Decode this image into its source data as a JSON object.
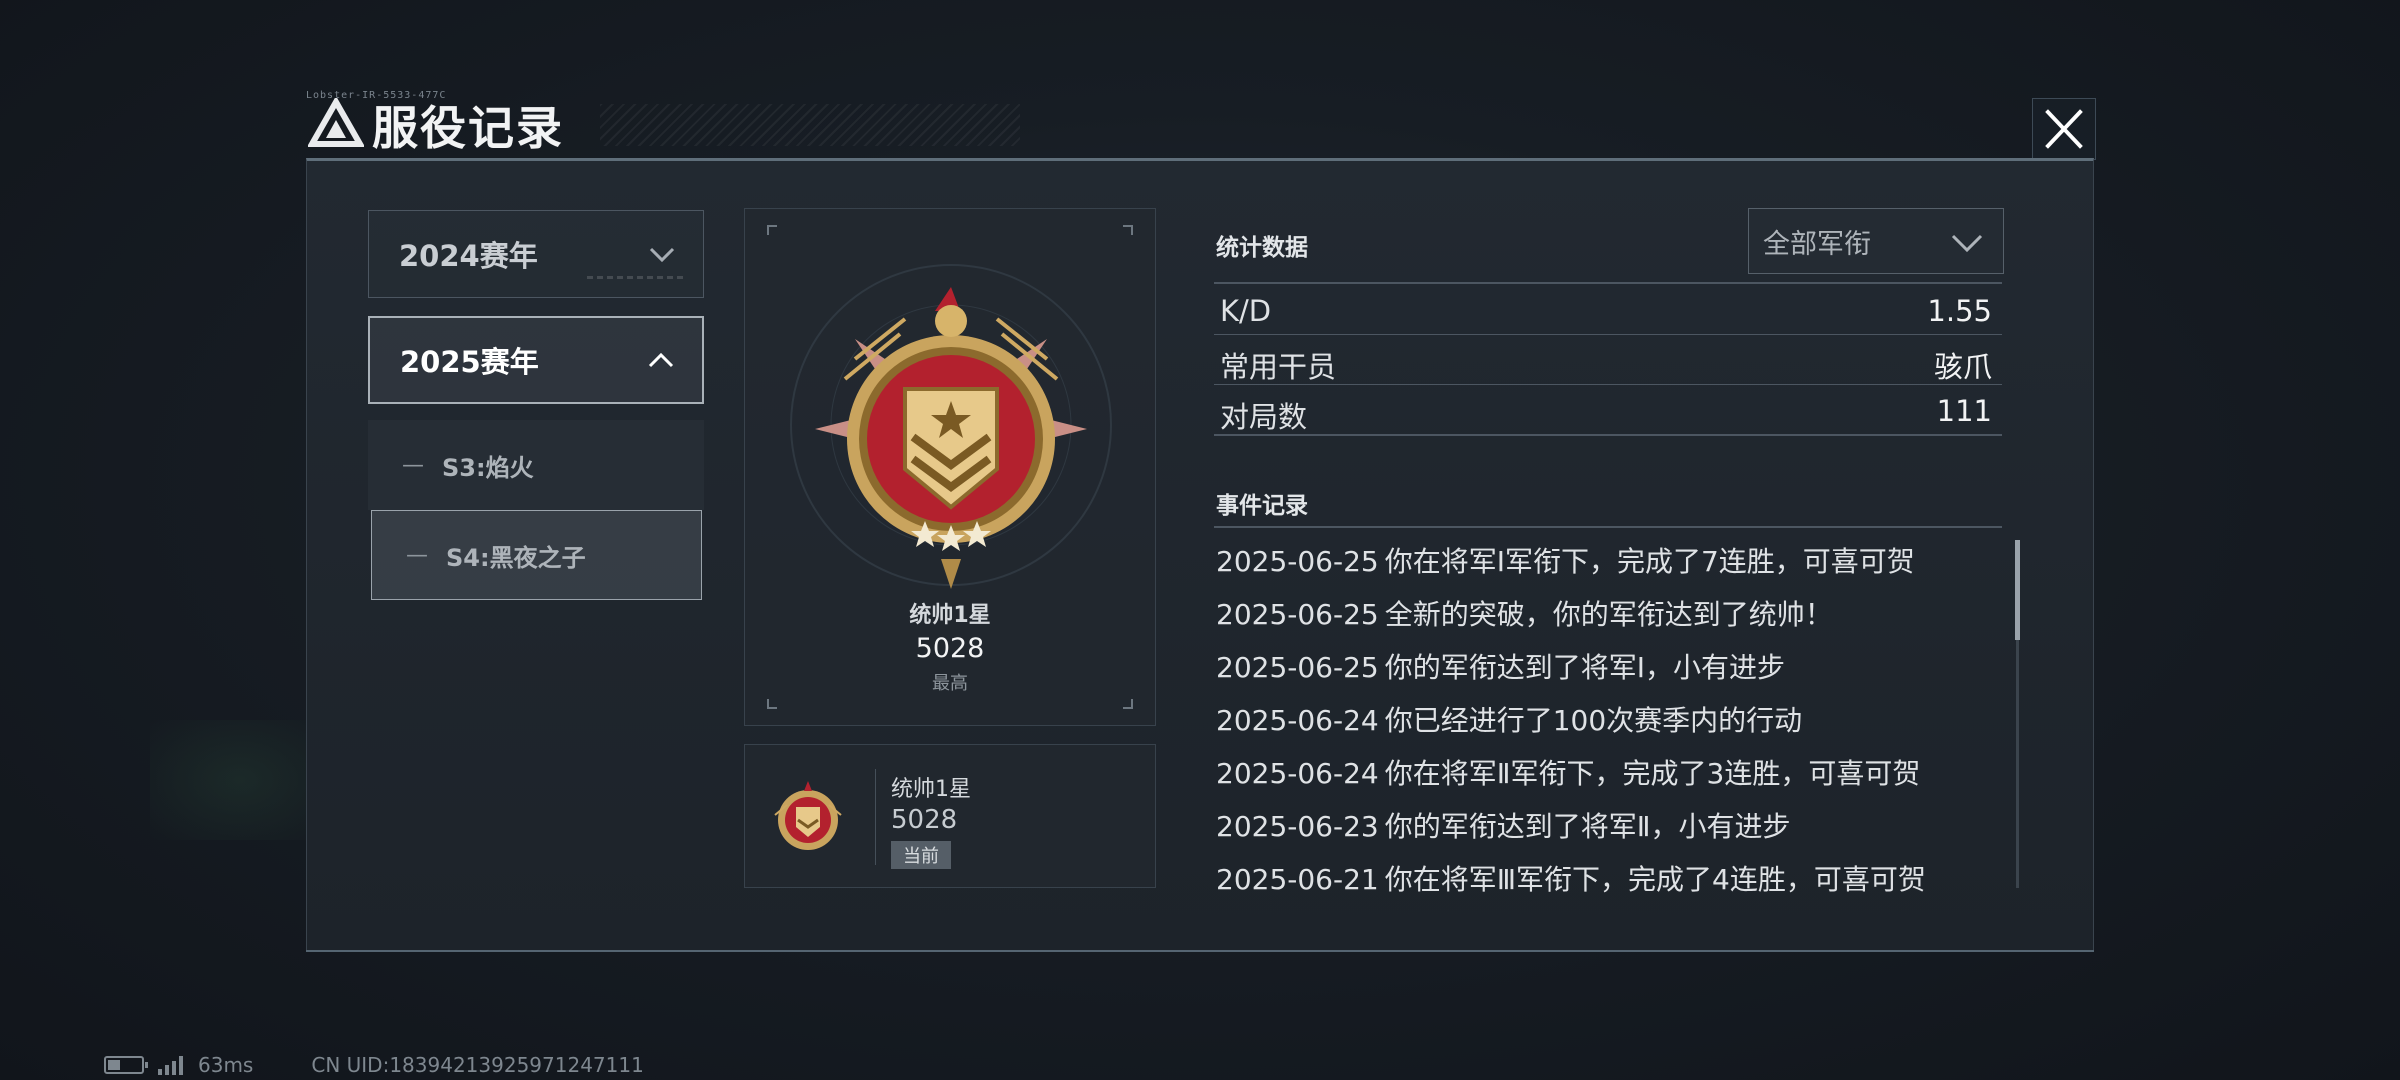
{
  "header": {
    "title": "服役记录",
    "code": "Lobster-IR-5533-477C",
    "close_icon": "close-icon"
  },
  "seasons": [
    {
      "label": "2024赛年",
      "expanded": false
    },
    {
      "label": "2025赛年",
      "expanded": true,
      "subs": [
        {
          "label": "S3:焰火",
          "selected": false
        },
        {
          "label": "S4:黑夜之子",
          "selected": true
        }
      ]
    }
  ],
  "best_rank": {
    "name": "统帅1星",
    "score": "5028",
    "tag": "最高"
  },
  "current_rank": {
    "name": "统帅1星",
    "score": "5028",
    "tag": "当前"
  },
  "stats": {
    "title": "统计数据",
    "filter": "全部军衔",
    "rows": [
      {
        "key": "K/D",
        "value": "1.55"
      },
      {
        "key": "常用干员",
        "value": "骇爪"
      },
      {
        "key": "对局数",
        "value": "111"
      }
    ]
  },
  "events": {
    "title": "事件记录",
    "items": [
      {
        "date": "2025-06-25",
        "text": "你在将军Ⅰ军衔下，完成了7连胜，可喜可贺"
      },
      {
        "date": "2025-06-25",
        "text": "全新的突破，你的军衔达到了统帅！"
      },
      {
        "date": "2025-06-25",
        "text": "你的军衔达到了将军Ⅰ，小有进步"
      },
      {
        "date": "2025-06-24",
        "text": "你已经进行了100次赛季内的行动"
      },
      {
        "date": "2025-06-24",
        "text": "你在将军Ⅱ军衔下，完成了3连胜，可喜可贺"
      },
      {
        "date": "2025-06-23",
        "text": "你的军衔达到了将军Ⅱ，小有进步"
      },
      {
        "date": "2025-06-21",
        "text": "你在将军Ⅲ军衔下，完成了4连胜，可喜可贺"
      }
    ]
  },
  "footer": {
    "ping": "63ms",
    "uid": "CN UID:1839421392597124711​1"
  },
  "colors": {
    "accent_red": "#b3212e",
    "gold": "#d7b46a",
    "panel": "#1f262d"
  }
}
